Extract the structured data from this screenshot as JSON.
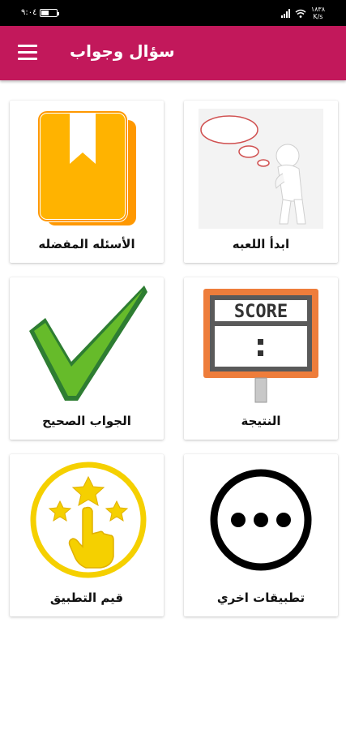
{
  "status_bar": {
    "time": "٩:٠٤",
    "network_speed": "١٨٣٨",
    "speed_unit": "K/s",
    "battery_level_percent": 50,
    "icons": [
      "battery-icon",
      "wifi-icon",
      "signal-icon"
    ]
  },
  "app_bar": {
    "title": "سؤال وجواب",
    "menu_icon": "hamburger-menu-icon",
    "background_color": "#c2185b"
  },
  "menu": [
    {
      "label": "ابدأ اللعبه",
      "icon": "thinking-figure-icon"
    },
    {
      "label": "الأسئله المفضله",
      "icon": "bookmark-book-icon"
    },
    {
      "label": "النتيجة",
      "icon": "scoreboard-icon",
      "icon_text": "SCORE"
    },
    {
      "label": "الجواب الصحيح",
      "icon": "green-checkmark-icon"
    },
    {
      "label": "تطبيقات اخري",
      "icon": "more-dots-icon"
    },
    {
      "label": "قيم التطبيق",
      "icon": "rate-stars-hand-icon"
    }
  ]
}
